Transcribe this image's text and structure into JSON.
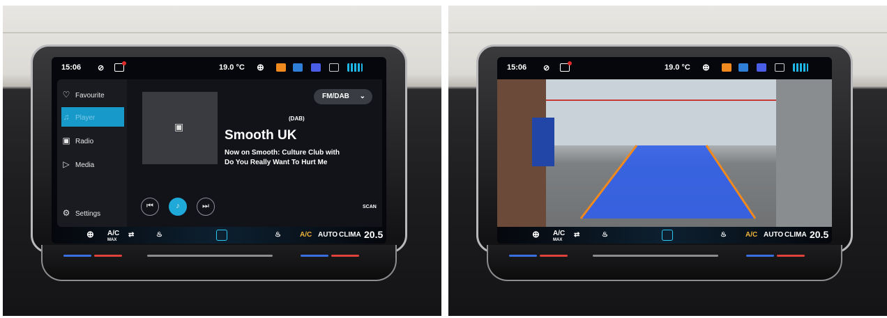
{
  "left": {
    "status": {
      "time": "15:06",
      "temperature": "19.0 °C"
    },
    "sidebar": {
      "items": [
        {
          "label": "Favourite",
          "icon": "heart-icon"
        },
        {
          "label": "Player",
          "icon": "music-note-icon"
        },
        {
          "label": "Radio",
          "icon": "radio-icon"
        },
        {
          "label": "Media",
          "icon": "play-circle-icon"
        },
        {
          "label": "Settings",
          "icon": "gear-icon"
        }
      ]
    },
    "player": {
      "source_dropdown": "FM/DAB",
      "band": "(DAB)",
      "station": "Smooth UK",
      "now_playing_line1": "Now on Smooth: Culture Club with",
      "now_playing_line2": "Do You Really Want To Hurt Me",
      "scan_label": "SCAN"
    },
    "climate": {
      "ac_max": "A/C",
      "ac_max_sub": "MAX",
      "ac": "A/C",
      "auto": "AUTO",
      "clima": "CLIMA",
      "set_temp": "20.5"
    }
  },
  "right": {
    "status": {
      "time": "15:06",
      "temperature": "19.0 °C"
    },
    "climate": {
      "ac_max": "A/C",
      "ac_max_sub": "MAX",
      "ac": "A/C",
      "auto": "AUTO",
      "clima": "CLIMA",
      "set_temp": "20.5"
    }
  },
  "colors": {
    "accent": "#1799c9",
    "ac_active": "#f0b43a",
    "guide_orange": "#f08a1e",
    "guide_blue": "#2f55d8",
    "notification_red": "#e12b2b"
  }
}
